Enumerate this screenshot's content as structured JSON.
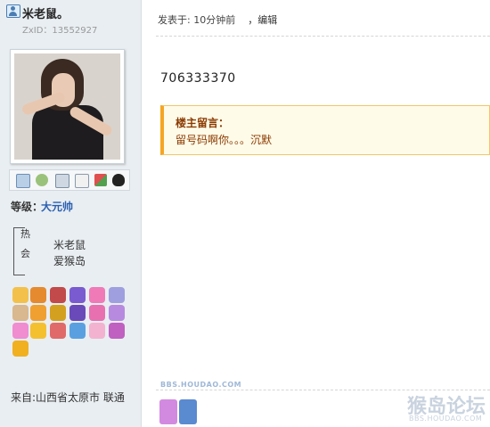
{
  "user": {
    "name": "米老鼠。",
    "zxid": "ZxID：13552927",
    "level_label": "等级：",
    "level_value": "大元帅",
    "badge_tag": [
      "热",
      "会"
    ],
    "badge_lines": [
      "米老鼠",
      "爱猴岛"
    ],
    "location": "来自:山西省太原市 联通"
  },
  "icons": [
    "mail-icon",
    "add-friend-icon",
    "search-profile-icon",
    "profile-card-icon",
    "game-icon",
    "qq-icon"
  ],
  "post": {
    "meta": "发表于: 10分钟前",
    "edit_label": "，编辑",
    "number": "706333370",
    "note_title": "楼主留言：",
    "note_text": "留号码啊你。。。沉默"
  },
  "branding": {
    "watermark_small": "BBS.HOUDAO.COM",
    "logo": "猴岛论坛",
    "logo_sub": "BBS.HOUDAO.COM"
  },
  "colors": {
    "sidebar_bg": "#e9eef2",
    "level_value": "#2a5fb0",
    "note_border": "#f5a623",
    "note_text": "#8a3a00"
  }
}
